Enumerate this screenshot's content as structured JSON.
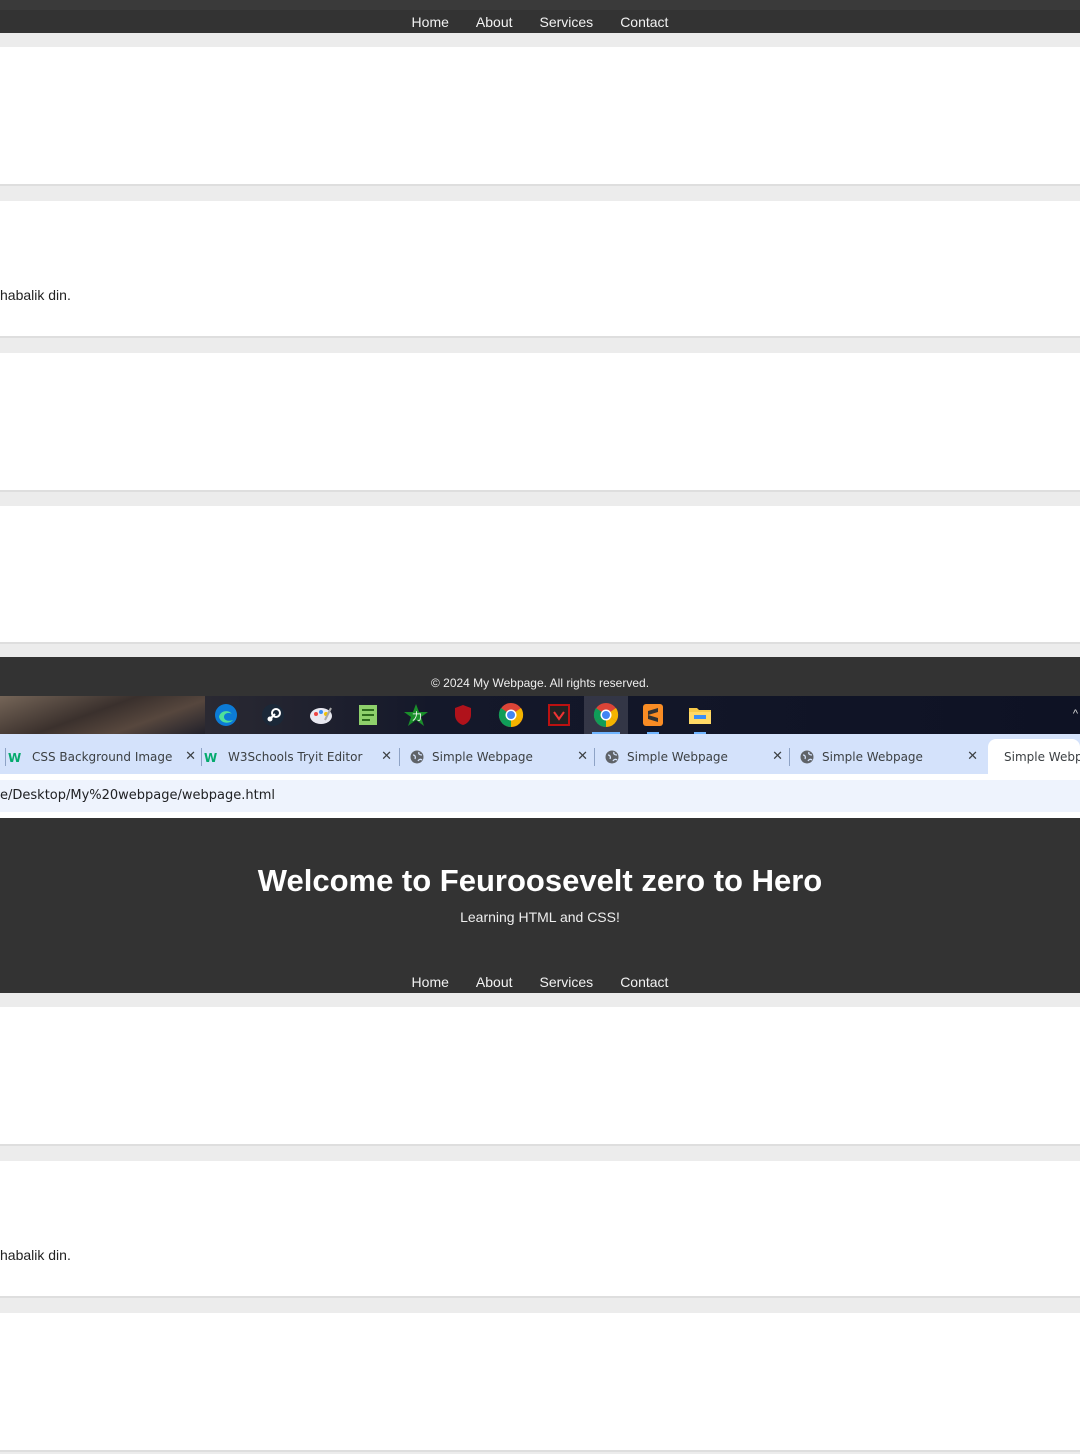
{
  "nav": {
    "items": [
      "Home",
      "About",
      "Services",
      "Contact"
    ]
  },
  "sections": {
    "paragraph_text": "habalik din."
  },
  "footer": {
    "copyright": "© 2024 My Webpage. All rights reserved."
  },
  "taskbar": {
    "icons": [
      "edge-icon",
      "steam-icon",
      "paint-icon",
      "notepad-icon",
      "game-icon",
      "shield-icon",
      "chrome-icon",
      "app-icon",
      "chrome-active-icon",
      "sublime-icon",
      "file-explorer-icon"
    ]
  },
  "browser": {
    "tabs": [
      {
        "label": "CSS Background Image",
        "icon": "w3schools-icon"
      },
      {
        "label": "W3Schools Tryit Editor",
        "icon": "w3schools-icon"
      },
      {
        "label": "Simple Webpage",
        "icon": "globe-icon"
      },
      {
        "label": "Simple Webpage",
        "icon": "globe-icon"
      },
      {
        "label": "Simple Webpage",
        "icon": "globe-icon"
      },
      {
        "label": "Simple Webpage",
        "icon": "globe-icon"
      }
    ],
    "close_glyph": "✕",
    "url": "e/Desktop/My%20webpage/webpage.html"
  },
  "header": {
    "title": "Welcome to Feuroosevelt zero to Hero",
    "subtitle": "Learning HTML and CSS!"
  },
  "colors": {
    "dark": "#333333",
    "tabbar": "#d4e2fb",
    "address_field": "#eef3fd"
  }
}
